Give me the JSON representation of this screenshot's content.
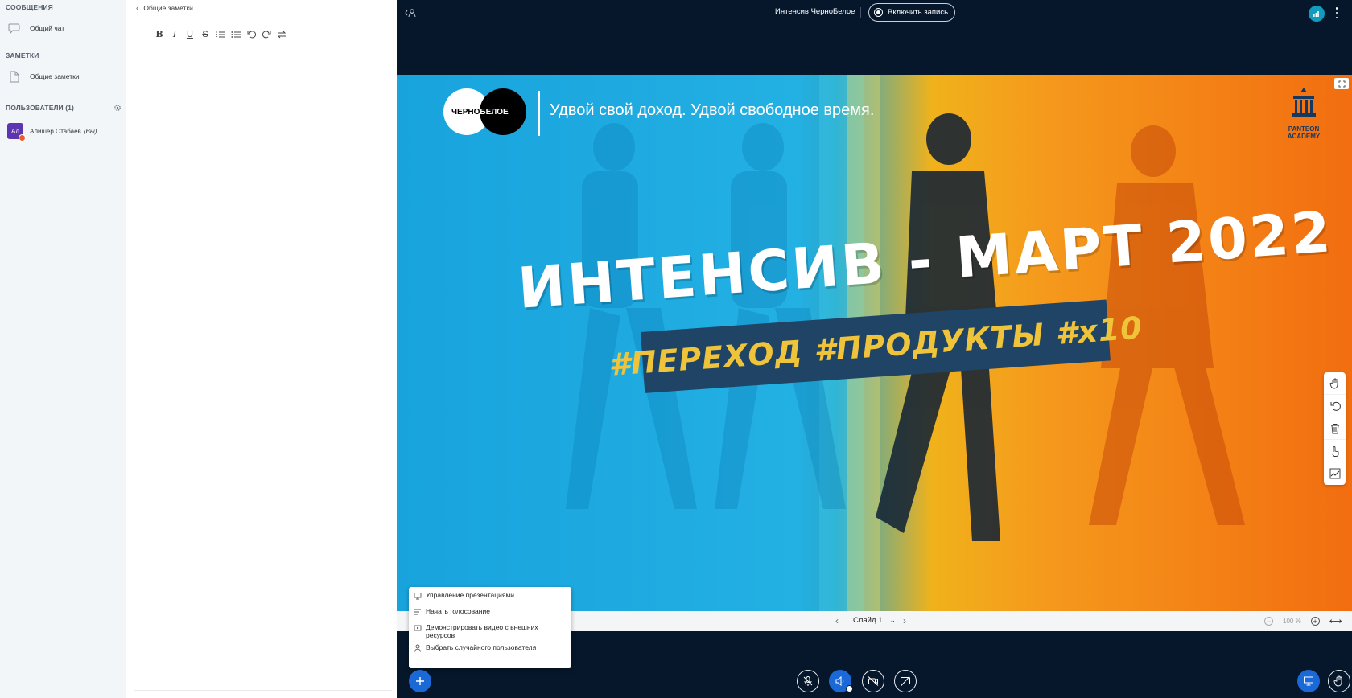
{
  "sidebar": {
    "messages_title": "СООБЩЕНИЯ",
    "public_chat": "Общий чат",
    "notes_title": "ЗАМЕТКИ",
    "shared_notes": "Общие заметки",
    "users_title": "ПОЛЬЗОВАТЕЛИ (1)",
    "user": {
      "avatar": "Ал",
      "name": "Алишер Отабаев",
      "suffix": "(Вы)"
    }
  },
  "notes": {
    "header": "Общие заметки",
    "toolbar": [
      "bold",
      "italic",
      "underline",
      "strikethrough",
      "ordered-list",
      "bullet-list",
      "undo",
      "redo",
      "convert"
    ]
  },
  "topbar": {
    "title": "Интенсив ЧерноБелое",
    "record_label": "Включить запись"
  },
  "slide": {
    "logo_left": "ЧЕРНО",
    "logo_right": "БЕЛОЕ",
    "slogan": "Удвой свой доход. Удвой свободное время.",
    "headline": "ИНТЕНСИВ - МАРТ 2022",
    "banner": "#ПЕРЕХОД #ПРОДУКТЫ #х10",
    "academy": "PANTEON ACADEMY"
  },
  "slidenav": {
    "slide_label": "Слайд 1",
    "zoom": "100 %"
  },
  "actions_menu": [
    {
      "label": "Управление презентациями",
      "icon": "presentation-icon"
    },
    {
      "label": "Начать голосование",
      "icon": "poll-icon"
    },
    {
      "label": "Демонстрировать видео с внешних ресурсов",
      "icon": "external-video-icon"
    },
    {
      "label": "Выбрать случайного пользователя",
      "icon": "random-user-icon"
    }
  ],
  "colors": {
    "accent": "#1b69d6",
    "background": "#06172b",
    "banner": "#1f4466",
    "banner_text": "#f0c43a"
  }
}
